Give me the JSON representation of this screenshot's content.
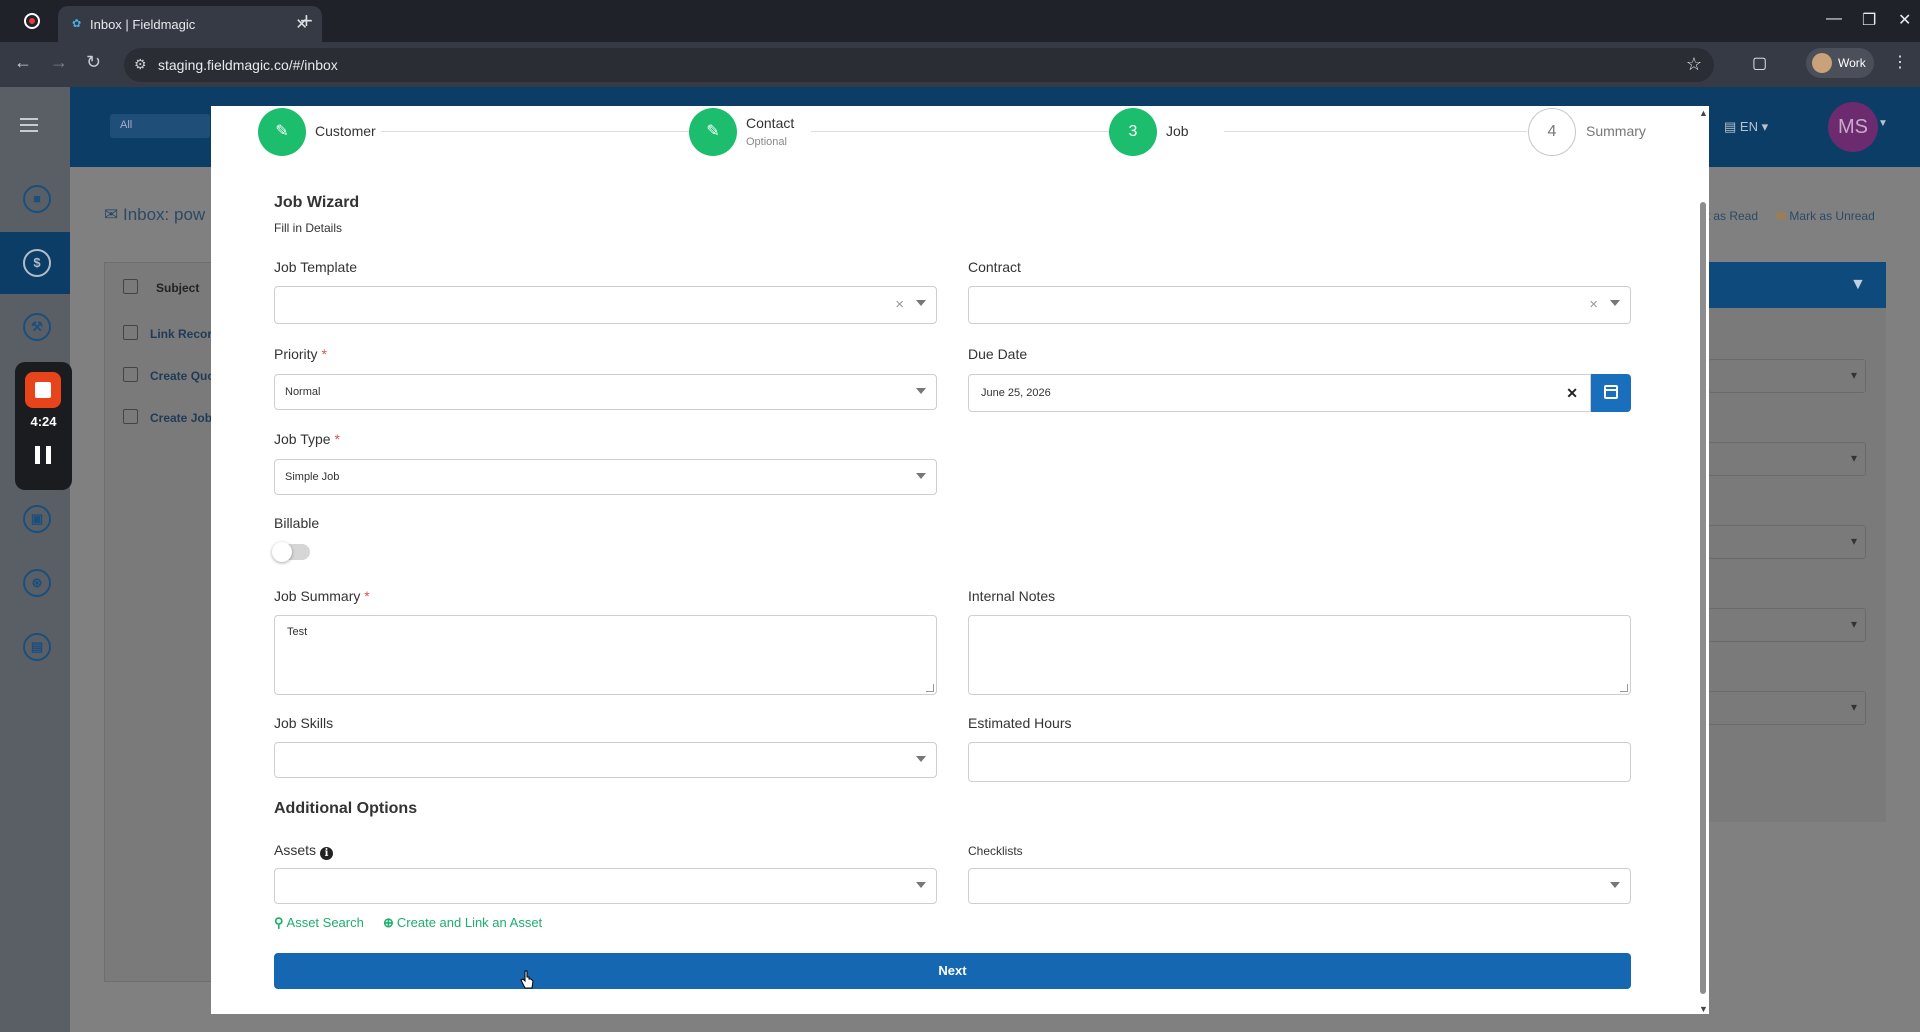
{
  "browser": {
    "tab_title": "Inbox | Fieldmagic",
    "url": "staging.fieldmagic.co/#/inbox",
    "profile_label": "Work"
  },
  "app": {
    "search_scope": "All",
    "language": "EN",
    "user_initials": "MS",
    "inbox_title": "Inbox: pow",
    "mark_as_read": "rk as Read",
    "mark_as_unread": "Mark as Unread",
    "table_header_subject": "Subject",
    "rows": [
      "Link Recor",
      "Create Quo",
      "Create Job"
    ],
    "recording_time": "4:24"
  },
  "wizard": {
    "steps": [
      {
        "number": "",
        "label": "Customer",
        "sub": "",
        "state": "done"
      },
      {
        "number": "",
        "label": "Contact",
        "sub": "Optional",
        "state": "done"
      },
      {
        "number": "3",
        "label": "Job",
        "sub": "",
        "state": "active"
      },
      {
        "number": "4",
        "label": "Summary",
        "sub": "",
        "state": "todo"
      }
    ],
    "title": "Job Wizard",
    "subtitle": "Fill in Details",
    "fields": {
      "job_template": {
        "label": "Job Template",
        "value": ""
      },
      "contract": {
        "label": "Contract",
        "value": ""
      },
      "priority": {
        "label": "Priority",
        "required_mark": "*",
        "value": "Normal"
      },
      "due_date": {
        "label": "Due Date",
        "value": "June 25, 2026"
      },
      "job_type": {
        "label": "Job Type",
        "required_mark": "*",
        "value": "Simple Job"
      },
      "billable": {
        "label": "Billable",
        "checked": false
      },
      "job_summary": {
        "label": "Job Summary",
        "required_mark": "*",
        "value": "Test"
      },
      "internal_notes": {
        "label": "Internal Notes",
        "value": ""
      },
      "job_skills": {
        "label": "Job Skills",
        "value": ""
      },
      "estimated_hours": {
        "label": "Estimated Hours",
        "value": ""
      }
    },
    "additional_options_title": "Additional Options",
    "assets_label": "Assets",
    "checklists_label": "Checklists",
    "asset_search_link": "Asset Search",
    "create_link_asset": "Create and Link an Asset",
    "next_button": "Next"
  },
  "colors": {
    "primary": "#1567b2",
    "success": "#1cbd6d",
    "header_bg": "#0c3d66"
  }
}
